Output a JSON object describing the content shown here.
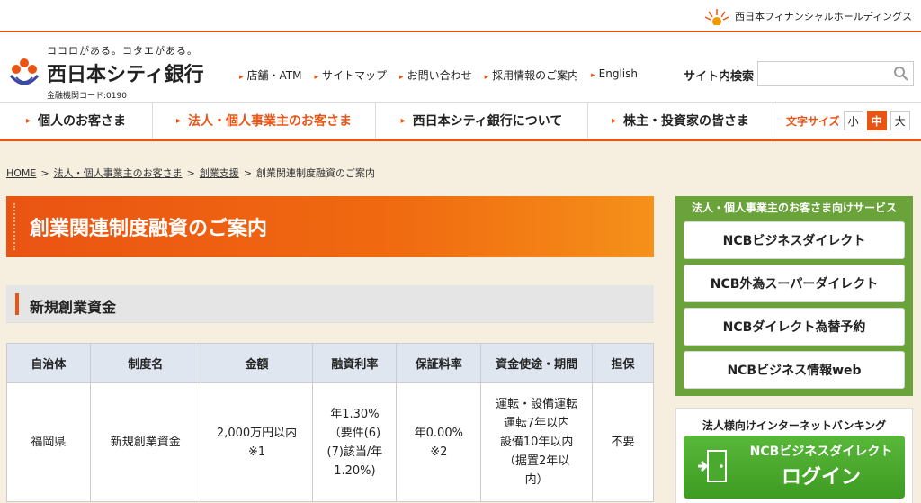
{
  "top": {
    "group_name": "西日本フィナンシャルホールディングス"
  },
  "header": {
    "tagline": "ココロがある。コタエがある。",
    "bank_name": "西日本シティ銀行",
    "bank_code": "金融機関コード:0190",
    "links": [
      "店舗・ATM",
      "サイトマップ",
      "お問い合わせ",
      "採用情報のご案内",
      "English"
    ],
    "search_label": "サイト内検索",
    "search_placeholder": ""
  },
  "gnav": {
    "items": [
      "個人のお客さま",
      "法人・個人事業主のお客さま",
      "西日本シティ銀行について",
      "株主・投資家の皆さま"
    ],
    "font_size_label": "文字サイズ",
    "font_sizes": [
      "小",
      "中",
      "大"
    ]
  },
  "breadcrumb": [
    "HOME",
    "法人・個人事業主のお客さま",
    "創業支援",
    "創業関連制度融資のご案内"
  ],
  "page_title": "創業関連制度融資のご案内",
  "section_title": "新規創業資金",
  "table": {
    "headers": [
      "自治体",
      "制度名",
      "金額",
      "融資利率",
      "保証料率",
      "資金使途・期間",
      "担保"
    ],
    "row": {
      "municipality": "福岡県",
      "program": "新規創業資金",
      "amount": [
        "2,000万円以内",
        "※1"
      ],
      "rate": [
        "年1.30%",
        "（要件(6)",
        "(7)該当/年",
        "1.20%)"
      ],
      "guarantee": [
        "年0.00%",
        "※2"
      ],
      "usage": [
        "運転・設備運転",
        "運転7年以内",
        "設備10年以内",
        "（据置2年以",
        "内）"
      ],
      "collateral": "不要"
    }
  },
  "sidebar": {
    "title": "法人・個人事業主のお客さま向けサービス",
    "buttons": [
      "NCBビジネスダイレクト",
      "NCB外為スーパーダイレクト",
      "NCBダイレクト為替予約",
      "NCBビジネス情報web"
    ],
    "ib_title": "法人様向けインターネットバンキング",
    "login_line1": "NCBビジネスダイレクト",
    "login_line2": "ログイン"
  },
  "colors": {
    "accent": "#ea5413",
    "side_green": "#6aa33a",
    "table_head": "#dfe6ef",
    "bg": "#f6efe0"
  }
}
